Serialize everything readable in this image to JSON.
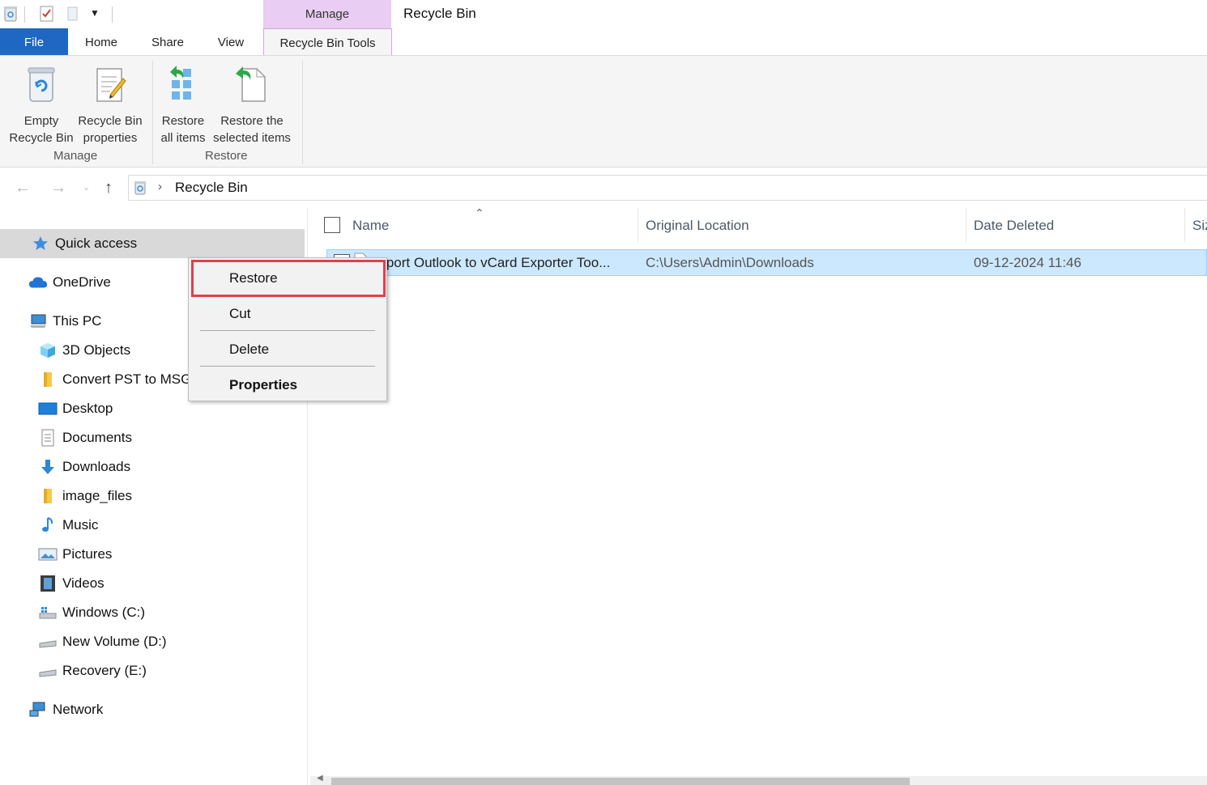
{
  "window": {
    "title": "Recycle Bin",
    "context_tab_group": "Manage"
  },
  "tabs": {
    "file": "File",
    "home": "Home",
    "share": "Share",
    "view": "View",
    "active": "Recycle Bin Tools"
  },
  "ribbon": {
    "empty_line1": "Empty",
    "empty_line2": "Recycle Bin",
    "props_line1": "Recycle Bin",
    "props_line2": "properties",
    "restore_all_line1": "Restore",
    "restore_all_line2": "all items",
    "restore_sel_line1": "Restore the",
    "restore_sel_line2": "selected items",
    "group_manage": "Manage",
    "group_restore": "Restore"
  },
  "address": {
    "crumb": "Recycle Bin"
  },
  "sidebar": {
    "quick_access": "Quick access",
    "onedrive": "OneDrive",
    "this_pc": "This PC",
    "objects3d": "3D Objects",
    "convert": "Convert PST to MSG",
    "desktop": "Desktop",
    "documents": "Documents",
    "downloads": "Downloads",
    "image_files": "image_files",
    "music": "Music",
    "pictures": "Pictures",
    "videos": "Videos",
    "drive_c": "Windows (C:)",
    "drive_d": "New Volume (D:)",
    "drive_e": "Recovery (E:)",
    "network": "Network"
  },
  "columns": {
    "name": "Name",
    "location": "Original Location",
    "date": "Date Deleted",
    "size": "Size"
  },
  "row": {
    "name": "Export Outlook to vCard Exporter Too...",
    "location": "C:\\Users\\Admin\\Downloads",
    "date": "09-12-2024 11:46"
  },
  "context_menu": {
    "restore": "Restore",
    "cut": "Cut",
    "delete": "Delete",
    "properties": "Properties"
  },
  "colors": {
    "file_tab": "#1e67c3",
    "context_tab": "#e9cdf2",
    "selection": "#cce8ff",
    "highlight_box": "#e0404a"
  }
}
